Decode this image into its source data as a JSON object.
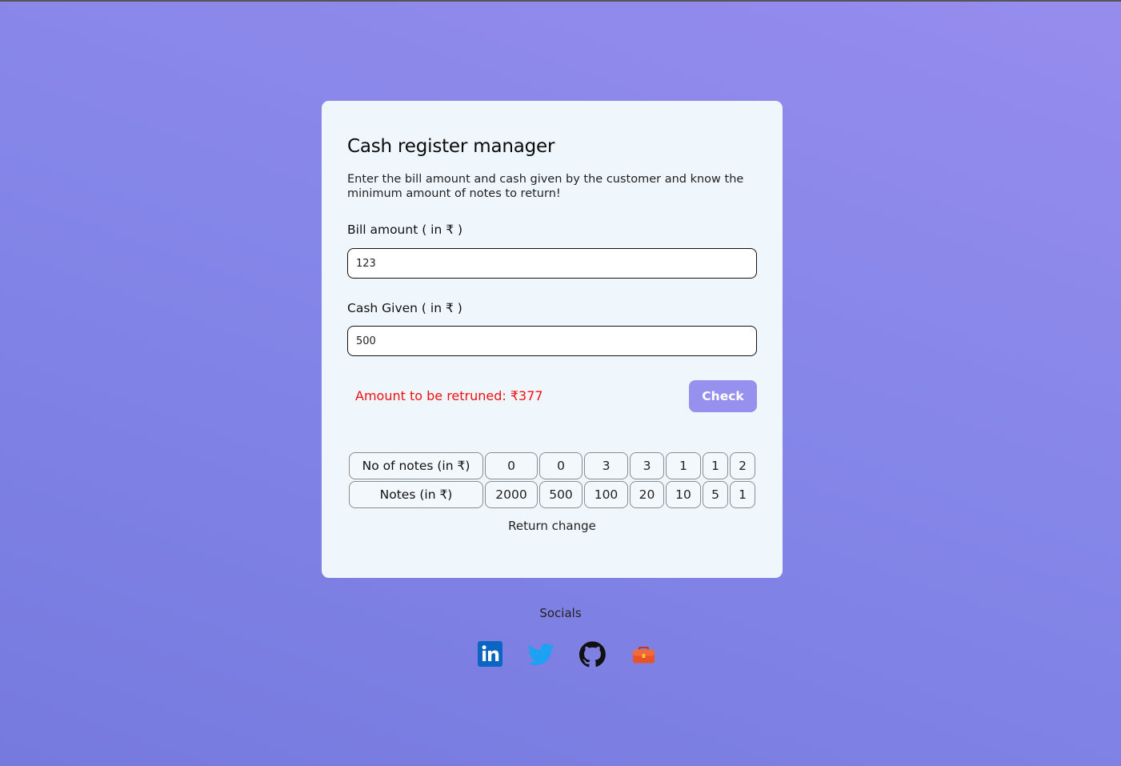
{
  "app": {
    "title": "Cash register manager",
    "description": "Enter the bill amount and cash given by the customer and know the minimum amount of notes to return!"
  },
  "form": {
    "bill_label": "Bill amount ( in ₹ )",
    "bill_value": "123",
    "cash_label": "Cash Given ( in ₹ )",
    "cash_value": "500",
    "result_text": "Amount to be retruned: ₹377",
    "check_label": "Check"
  },
  "change_table": {
    "count_header": "No of notes (in ₹)",
    "notes_header": "Notes (in ₹)",
    "counts": [
      "0",
      "0",
      "3",
      "3",
      "1",
      "1",
      "2"
    ],
    "notes": [
      "2000",
      "500",
      "100",
      "20",
      "10",
      "5",
      "1"
    ],
    "caption": "Return change"
  },
  "socials": {
    "title": "Socials",
    "items": [
      {
        "icon": "linkedin-icon",
        "color": "#0a66c2"
      },
      {
        "icon": "twitter-icon",
        "color": "#1da1f2"
      },
      {
        "icon": "github-icon",
        "color": "#111111"
      },
      {
        "icon": "portfolio-briefcase-icon",
        "color": "#e8532a"
      }
    ]
  }
}
